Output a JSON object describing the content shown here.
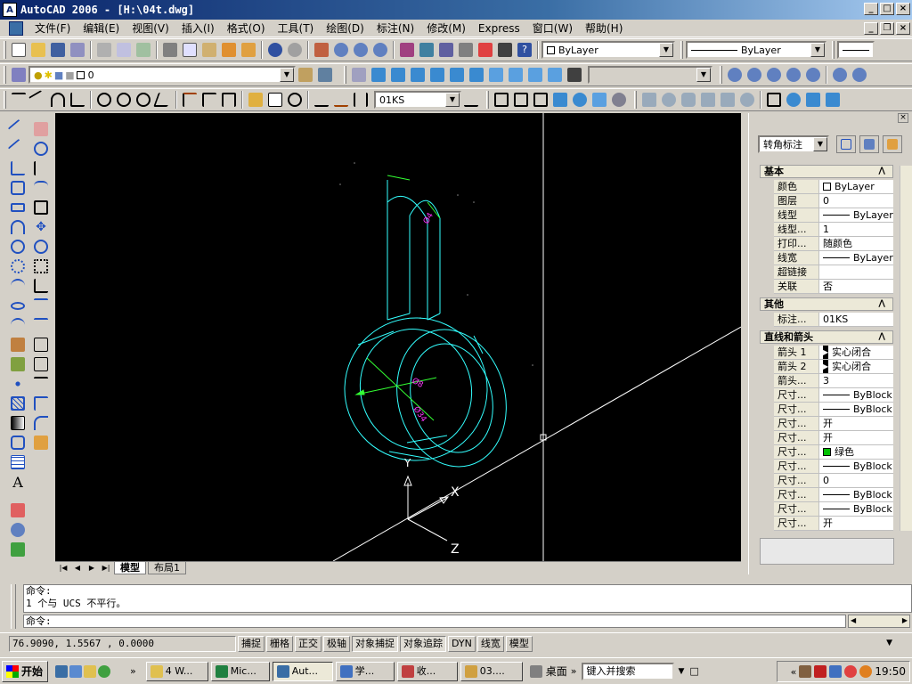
{
  "window": {
    "title": "AutoCAD 2006 - [H:\\04t.dwg]",
    "app_icon_label": "A"
  },
  "menu": [
    "文件(F)",
    "编辑(E)",
    "视图(V)",
    "插入(I)",
    "格式(O)",
    "工具(T)",
    "绘图(D)",
    "标注(N)",
    "修改(M)",
    "Express",
    "窗口(W)",
    "帮助(H)"
  ],
  "toolbars": {
    "color_combo": "ByLayer",
    "linetype_combo": "ByLayer",
    "layer_combo": "0",
    "dimstyle_combo": "01KS"
  },
  "model_tabs": [
    "模型",
    "布局1"
  ],
  "properties": {
    "object_type": "转角标注",
    "sections": [
      {
        "title": "基本",
        "rows": [
          {
            "k": "颜色",
            "v": "ByLayer"
          },
          {
            "k": "图层",
            "v": "0"
          },
          {
            "k": "线型",
            "v": "ByLayer"
          },
          {
            "k": "线型...",
            "v": "1"
          },
          {
            "k": "打印...",
            "v": "随颜色"
          },
          {
            "k": "线宽",
            "v": "ByLayer"
          },
          {
            "k": "超链接",
            "v": ""
          },
          {
            "k": "关联",
            "v": "否"
          }
        ]
      },
      {
        "title": "其他",
        "rows": [
          {
            "k": "标注...",
            "v": "01KS"
          }
        ]
      },
      {
        "title": "直线和箭头",
        "rows": [
          {
            "k": "箭头 1",
            "v": "实心闭合"
          },
          {
            "k": "箭头 2",
            "v": "实心闭合"
          },
          {
            "k": "箭头...",
            "v": "3"
          },
          {
            "k": "尺寸...",
            "v": "ByBlock"
          },
          {
            "k": "尺寸...",
            "v": "ByBlock"
          },
          {
            "k": "尺寸...",
            "v": "开"
          },
          {
            "k": "尺寸...",
            "v": "开"
          },
          {
            "k": "尺寸...",
            "v": "绿色"
          },
          {
            "k": "尺寸...",
            "v": "ByBlock"
          },
          {
            "k": "尺寸...",
            "v": "0"
          },
          {
            "k": "尺寸...",
            "v": "ByBlock"
          },
          {
            "k": "尺寸...",
            "v": "ByBlock"
          },
          {
            "k": "尺寸...",
            "v": "开"
          }
        ]
      }
    ]
  },
  "command": {
    "history": [
      "命令:",
      "1 个与 UCS 不平行。"
    ],
    "prompt": "命令:"
  },
  "status": {
    "coords": "76.9090, 1.5567 , 0.0000",
    "toggles": [
      {
        "label": "捕捉",
        "on": false
      },
      {
        "label": "栅格",
        "on": false
      },
      {
        "label": "正交",
        "on": false
      },
      {
        "label": "极轴",
        "on": false
      },
      {
        "label": "对象捕捉",
        "on": true
      },
      {
        "label": "对象追踪",
        "on": true
      },
      {
        "label": "DYN",
        "on": false
      },
      {
        "label": "线宽",
        "on": false
      },
      {
        "label": "模型",
        "on": false
      }
    ]
  },
  "canvas": {
    "ucs_labels": {
      "x": "X",
      "y": "Y",
      "z": "Z"
    },
    "dim_labels": [
      "Ø8",
      "Ø34",
      "Ø4"
    ]
  },
  "taskbar": {
    "start": "开始",
    "tasks": [
      {
        "label": "4 W...",
        "active": false
      },
      {
        "label": "Mic...",
        "active": false
      },
      {
        "label": "Aut...",
        "active": true
      },
      {
        "label": "学...",
        "active": false
      },
      {
        "label": "收...",
        "active": false
      },
      {
        "label": "03....",
        "active": false
      }
    ],
    "desktop": "桌面",
    "search_placeholder": "键入并搜索",
    "clock": "19:50"
  },
  "colors": {
    "drawing_cyan": "#33ffff",
    "dim_green": "#33ff33",
    "text_magenta": "#ff33ff",
    "title_blue": "#0a246a"
  }
}
